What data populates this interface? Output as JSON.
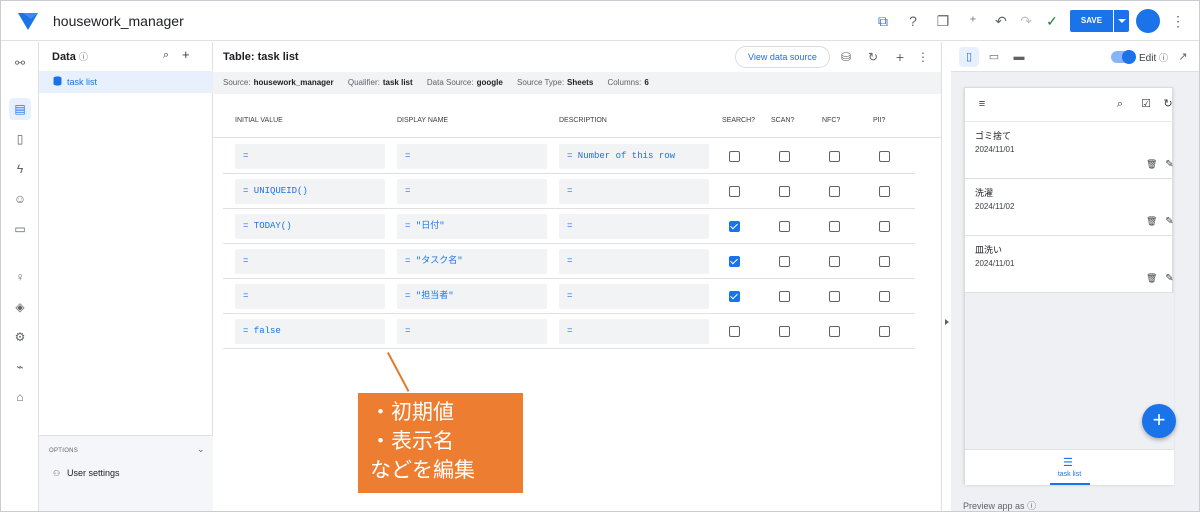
{
  "app": {
    "title": "housework_manager",
    "save_label": "SAVE"
  },
  "rail": {
    "icons": [
      "connect-icon",
      "data-icon",
      "views-icon",
      "automation-icon",
      "bot-icon",
      "chat-icon",
      "insights-icon",
      "security-icon",
      "settings-icon",
      "monitor-icon",
      "learn-icon"
    ]
  },
  "data_panel": {
    "title": "Data",
    "table_item": "task list",
    "options_label": "OPTIONS",
    "user_settings": "User settings"
  },
  "main": {
    "title": "Table: task list",
    "view_source": "View data source",
    "info": {
      "source_label": "Source:",
      "source": "housework_manager",
      "qualifier_label": "Qualifier:",
      "qualifier": "task list",
      "datasource_label": "Data Source:",
      "datasource": "google",
      "sourcetype_label": "Source Type:",
      "sourcetype": "Sheets",
      "columns_label": "Columns:",
      "columns": "6"
    },
    "headers": {
      "initial": "INITIAL VALUE",
      "display": "DISPLAY NAME",
      "description": "DESCRIPTION",
      "search": "SEARCH?",
      "scan": "SCAN?",
      "nfc": "NFC?",
      "pii": "PII?"
    },
    "rows": [
      {
        "initial": "=",
        "display": "=",
        "description": "= Number of this row",
        "search": false,
        "scan": false,
        "nfc": false,
        "pii": false
      },
      {
        "initial": "= UNIQUEID()",
        "display": "=",
        "description": "=",
        "search": false,
        "scan": false,
        "nfc": false,
        "pii": false
      },
      {
        "initial": "= TODAY()",
        "display": "= \"日付\"",
        "description": "=",
        "search": true,
        "scan": false,
        "nfc": false,
        "pii": false
      },
      {
        "initial": "=",
        "display": "= \"タスク名\"",
        "description": "=",
        "search": true,
        "scan": false,
        "nfc": false,
        "pii": false
      },
      {
        "initial": "=",
        "display": "= \"担当者\"",
        "description": "=",
        "search": true,
        "scan": false,
        "nfc": false,
        "pii": false
      },
      {
        "initial": "= false",
        "display": "=",
        "description": "=",
        "search": false,
        "scan": false,
        "nfc": false,
        "pii": false
      }
    ]
  },
  "callout": {
    "line1": "・初期値",
    "line2": "・表示名",
    "line3": "などを編集"
  },
  "preview": {
    "edit_label": "Edit",
    "items": [
      {
        "name": "ゴミ捨て",
        "date": "2024/11/01"
      },
      {
        "name": "洗濯",
        "date": "2024/11/02"
      },
      {
        "name": "皿洗い",
        "date": "2024/11/01"
      }
    ],
    "nav_label": "task list",
    "footer": "Preview app as"
  },
  "colors": {
    "accent": "#1a73e8",
    "callout": "#ed7d31",
    "cell_bg": "#f1f3f4"
  }
}
